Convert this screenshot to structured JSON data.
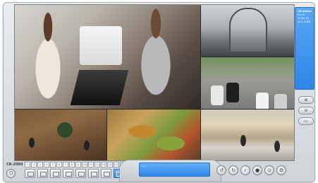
{
  "app": {
    "logo_text": "CR-2000",
    "power_icon": "power-icon"
  },
  "sidebar": {
    "lines": [
      "CH status",
      "20 ch",
      "10:02:45",
      "324 11GB"
    ],
    "color": "#2f86e8"
  },
  "side_buttons": [
    {
      "icon": "zoom-in-icon",
      "glyph": "⊕"
    },
    {
      "icon": "zoom-out-icon",
      "glyph": "⊖"
    },
    {
      "icon": "fullscreen-icon",
      "glyph": "▭"
    }
  ],
  "channels": [
    "1",
    "2",
    "3",
    "4",
    "5",
    "6",
    "7",
    "8",
    "9",
    "10",
    "11",
    "12",
    "13",
    "14",
    "15",
    "16"
  ],
  "layouts": [
    {
      "name": "layout-1x1"
    },
    {
      "name": "layout-2x2"
    },
    {
      "name": "layout-3x3"
    },
    {
      "name": "layout-4x4"
    },
    {
      "name": "layout-1-5"
    },
    {
      "name": "layout-1-7"
    },
    {
      "name": "layout-1-9"
    },
    {
      "name": "layout-6-split",
      "selected": true
    }
  ],
  "status_box": {
    "text": "----"
  },
  "controls": [
    {
      "icon": "rewind-icon",
      "glyph": "↺"
    },
    {
      "icon": "refresh-icon",
      "glyph": "↻"
    },
    {
      "icon": "search-icon",
      "glyph": "⌕"
    },
    {
      "icon": "record-icon",
      "glyph": "●"
    },
    {
      "icon": "playback-icon",
      "glyph": "⊙"
    },
    {
      "icon": "settings-icon",
      "glyph": "⚙"
    }
  ]
}
